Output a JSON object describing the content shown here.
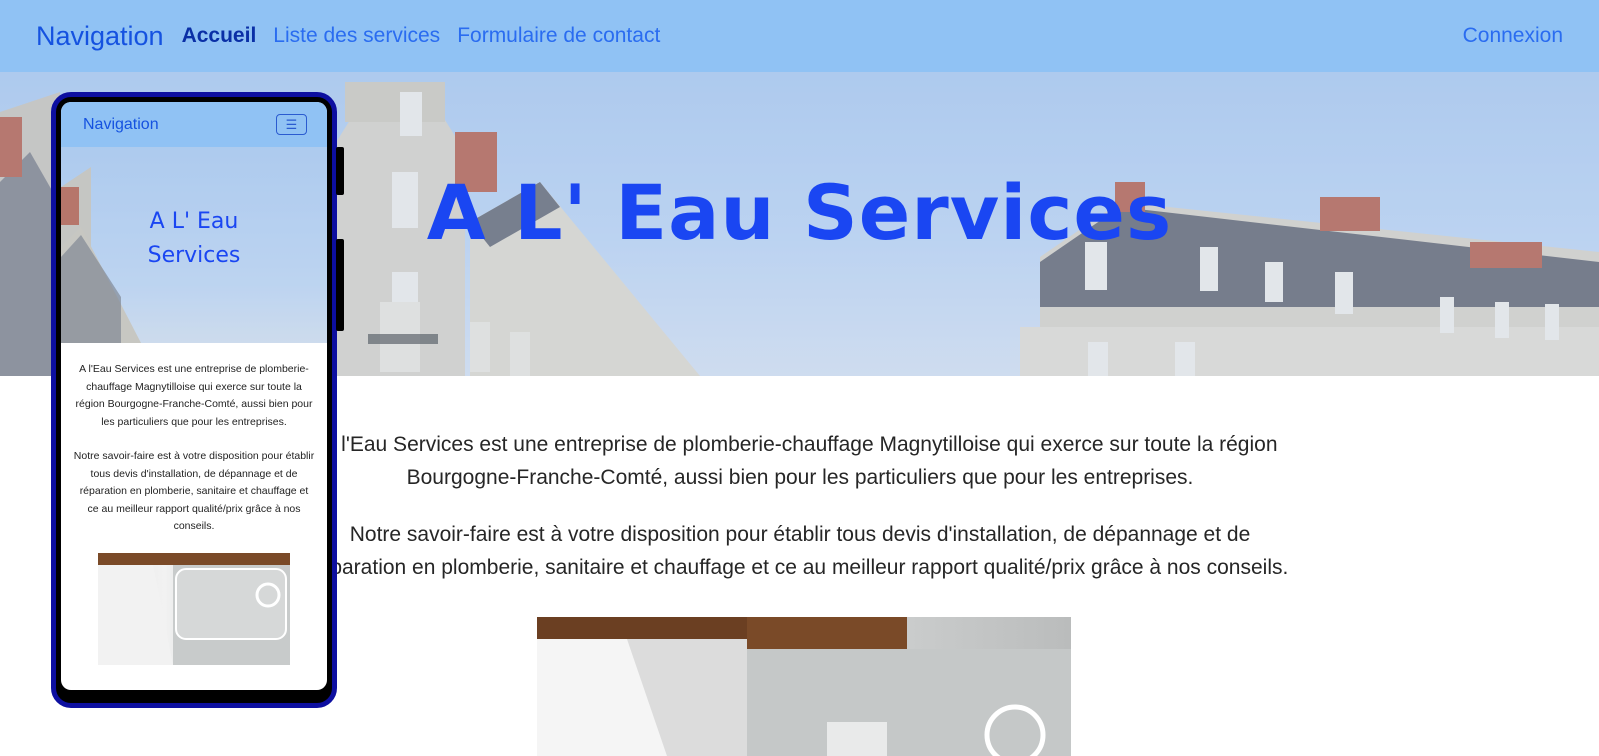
{
  "navbar": {
    "brand": "Navigation",
    "links": [
      {
        "label": "Accueil",
        "active": true
      },
      {
        "label": "Liste des services",
        "active": false
      },
      {
        "label": "Formulaire de contact",
        "active": false
      }
    ],
    "login": "Connexion"
  },
  "hero": {
    "title": "A L' Eau Services"
  },
  "content": {
    "paragraph1": "A l'Eau Services est une entreprise de plomberie-chauffage Magnytilloise qui exerce sur toute la région Bourgogne-Franche-Comté, aussi bien pour les particuliers que pour les entreprises.",
    "paragraph2": "Notre savoir-faire est à votre disposition pour établir tous devis d'installation, de dépannage et de réparation en plomberie, sanitaire et chauffage et ce au meilleur rapport qualité/prix grâce à nos conseils."
  },
  "mobile": {
    "brand": "Navigation",
    "toggle_icon": "hamburger-icon",
    "title_line1": "A L' Eau",
    "title_line2": "Services",
    "paragraph1": "A l'Eau Services est une entreprise de plomberie-chauffage Magnytilloise qui exerce sur toute la région Bourgogne-Franche-Comté, aussi bien pour les particuliers que pour les entreprises.",
    "paragraph2": "Notre savoir-faire est à votre disposition pour établir tous devis d'installation, de dépannage et de réparation en plomberie, sanitaire et chauffage et ce au meilleur rapport qualité/prix grâce à nos conseils."
  },
  "colors": {
    "navbar_bg": "#90c2f4",
    "brand": "#1552e0",
    "link": "#2a6cf0",
    "link_active": "#0a2fa6",
    "hero_title": "#1a46f2",
    "phone_border": "#0d0fa0"
  }
}
